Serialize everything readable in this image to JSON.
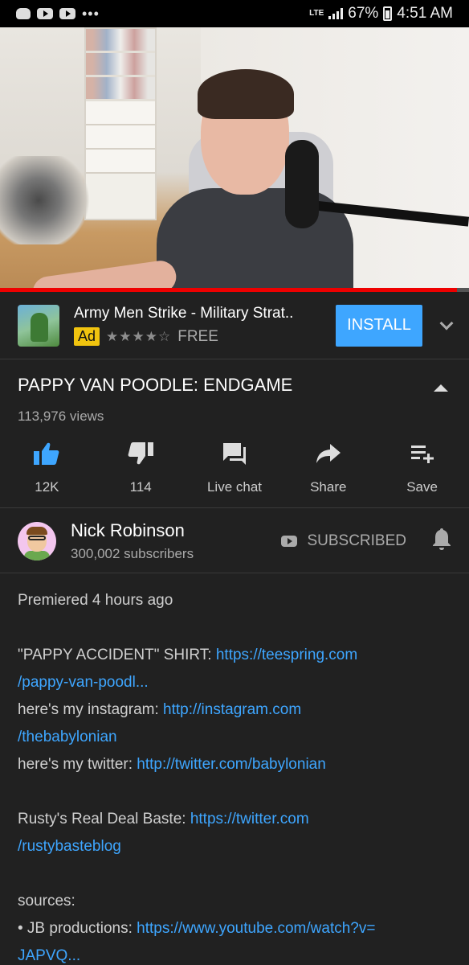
{
  "status_bar": {
    "network": "LTE",
    "battery": "67%",
    "time": "4:51 AM",
    "more": "•••"
  },
  "video": {
    "progress_fraction": 0.975
  },
  "ad": {
    "title": "Army Men Strike - Military Strat..",
    "badge": "Ad",
    "stars": "★★★★☆",
    "price": "FREE",
    "install_label": "INSTALL"
  },
  "title_section": {
    "title": "PAPPY VAN POODLE: ENDGAME",
    "views": "113,976 views"
  },
  "actions": {
    "like": "12K",
    "dislike": "114",
    "live_chat": "Live chat",
    "share": "Share",
    "save": "Save"
  },
  "channel": {
    "name": "Nick Robinson",
    "subscribers": "300,002 subscribers",
    "subscribed_label": "SUBSCRIBED"
  },
  "description": {
    "premiered": "Premiered 4 hours ago",
    "shirt_label": "\"PAPPY ACCIDENT\" SHIRT: ",
    "shirt_link_1": "https://teespring.com",
    "shirt_link_2": "/pappy-van-poodl...",
    "instagram_label": "here's my instagram: ",
    "instagram_link_1": "http://instagram.com",
    "instagram_link_2": "/thebabylonian",
    "twitter_label": "here's my twitter: ",
    "twitter_link": "http://twitter.com/babylonian",
    "rusty_label": "Rusty's Real Deal Baste: ",
    "rusty_link_1": "https://twitter.com",
    "rusty_link_2": "/rustybasteblog",
    "sources": "sources:",
    "jb_label": "• JB productions: ",
    "jb_link_1": "https://www.youtube.com/watch?v=",
    "jb_link_2": "JAPVQ..."
  },
  "colors": {
    "background": "#212121",
    "accent_blue": "#3ea6ff",
    "ad_yellow": "#f1c40f",
    "progress_red": "#e00000"
  }
}
